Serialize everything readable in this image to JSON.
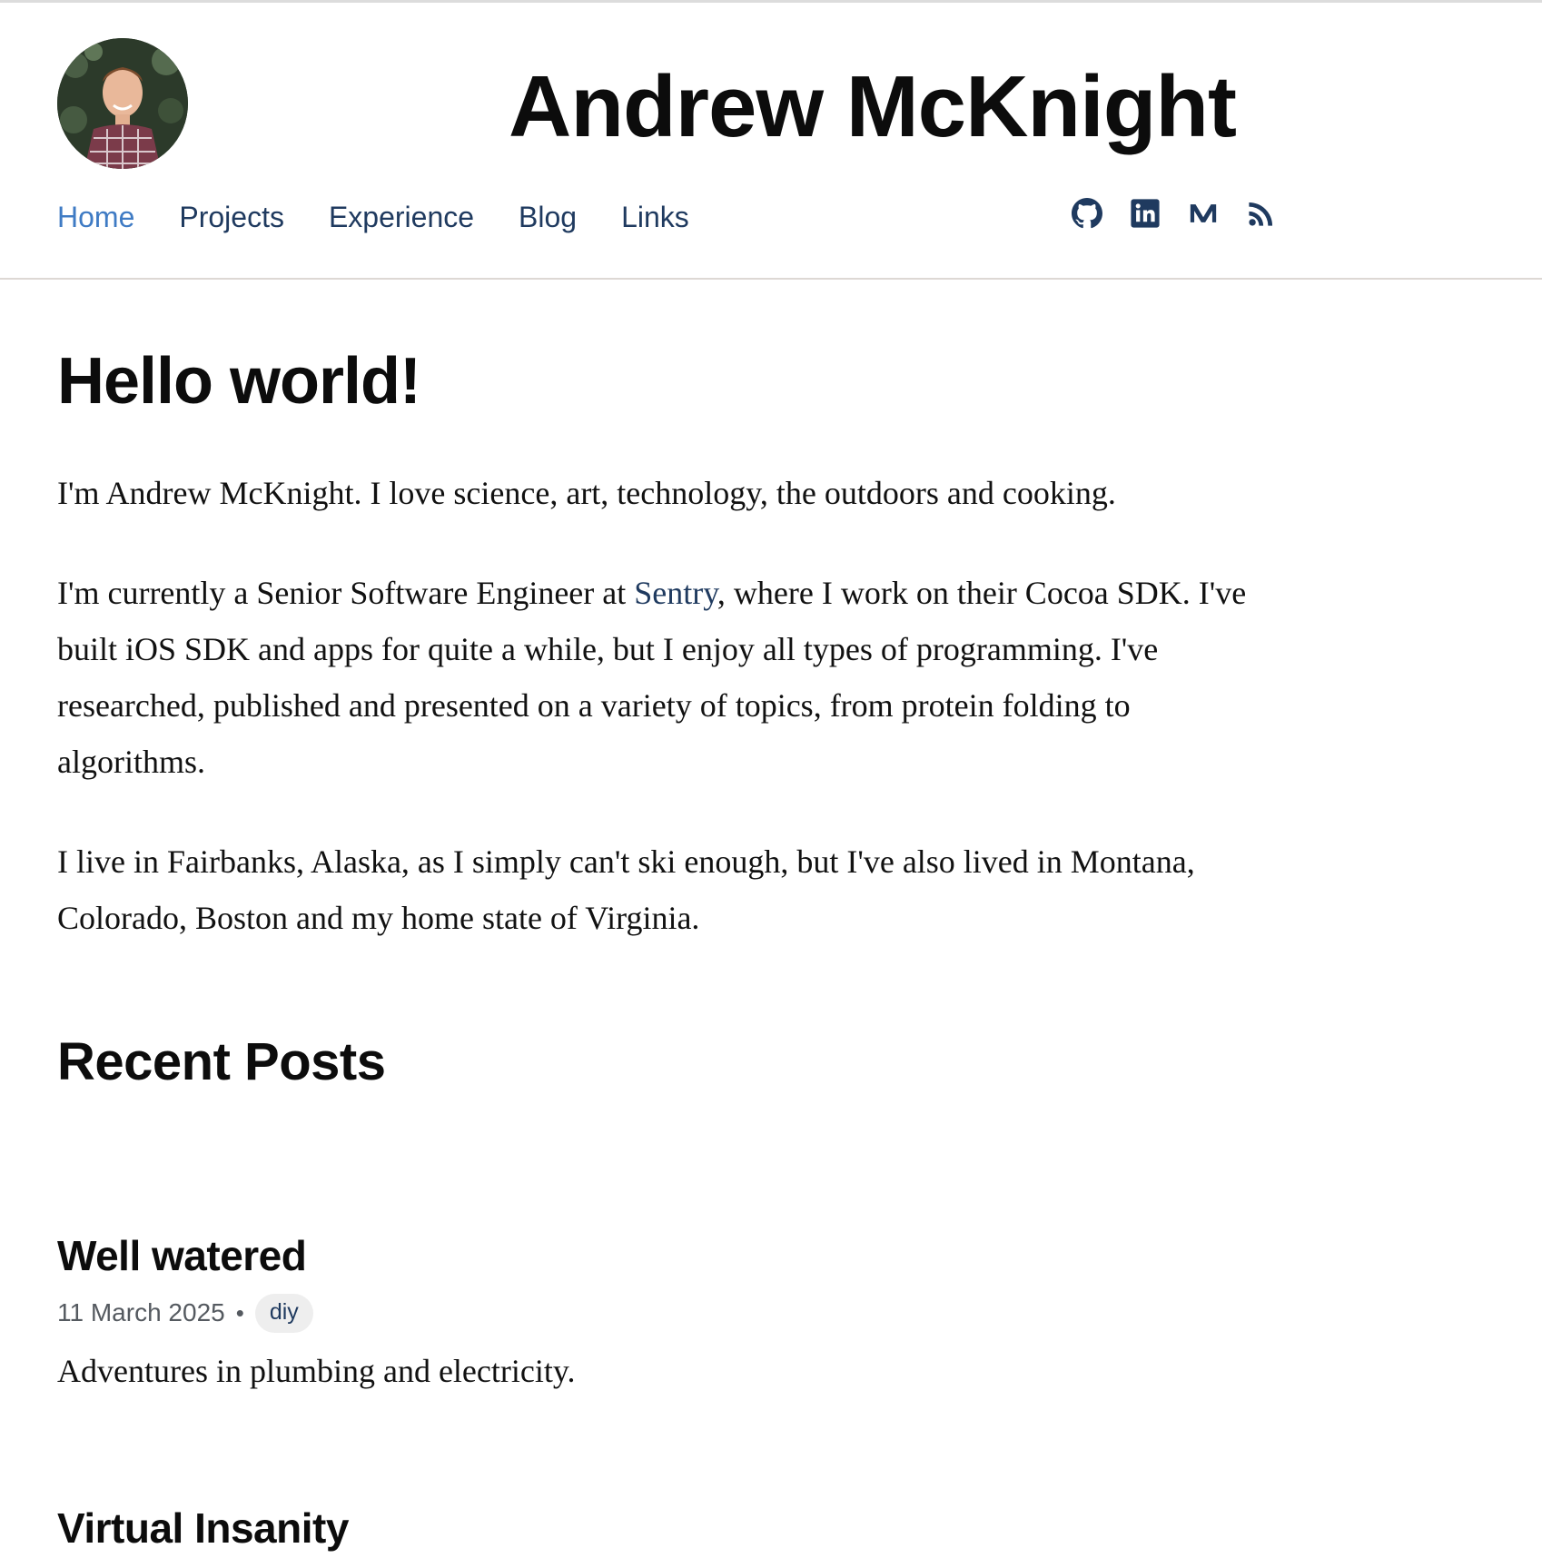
{
  "site": {
    "title": "Andrew McKnight",
    "avatar_alt": "avatar photo"
  },
  "nav": {
    "items": [
      {
        "label": "Home",
        "active": true
      },
      {
        "label": "Projects",
        "active": false
      },
      {
        "label": "Experience",
        "active": false
      },
      {
        "label": "Blog",
        "active": false
      },
      {
        "label": "Links",
        "active": false
      }
    ]
  },
  "social": {
    "icons": [
      "github-icon",
      "linkedin-icon",
      "medium-icon",
      "rss-icon"
    ]
  },
  "intro": {
    "heading": "Hello world!",
    "p1": "I'm Andrew McKnight. I love science, art, technology, the outdoors and cooking.",
    "p2_before": "I'm currently a Senior Software Engineer at ",
    "p2_link": "Sentry",
    "p2_after": ", where I work on their Cocoa SDK. I've built iOS SDK and apps for quite a while, but I enjoy all types of programming. I've researched, published and presented on a variety of topics, from protein folding to algorithms.",
    "p3": "I live in Fairbanks, Alaska, as I simply can't ski enough, but I've also lived in Montana, Colorado, Boston and my home state of Virginia."
  },
  "recent_posts": {
    "heading": "Recent Posts",
    "posts": [
      {
        "title": "Well watered",
        "date": "11 March 2025",
        "separator": "•",
        "tag": "diy",
        "description": "Adventures in plumbing and electricity."
      },
      {
        "title": "Virtual Insanity"
      }
    ]
  },
  "colors": {
    "nav_link": "#1f3a5f",
    "nav_active": "#3f7bc4",
    "text": "#111111",
    "tag_bg": "#eeeeee"
  }
}
